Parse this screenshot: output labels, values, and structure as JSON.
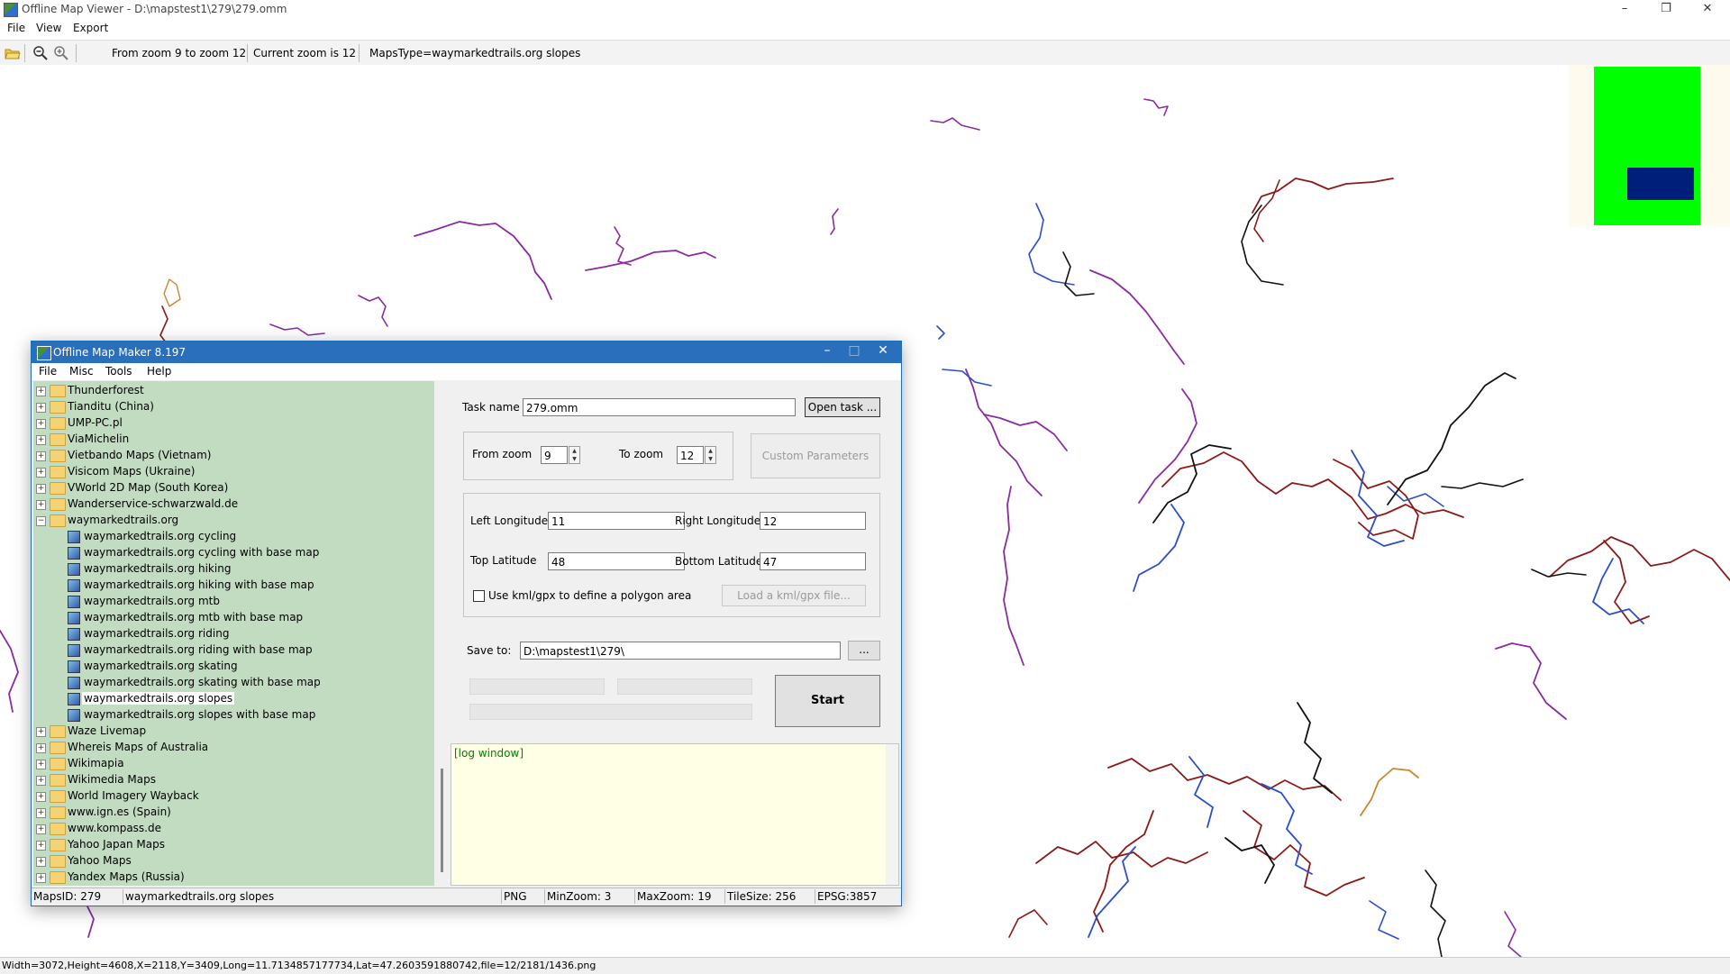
{
  "window": {
    "title": "Offline Map Viewer - D:\\mapstest1\\279\\279.omm",
    "minimize": "–",
    "restore": "❐",
    "close": "✕"
  },
  "menu": [
    "File",
    "View",
    "Export"
  ],
  "toolbar": {
    "zoom_range": "From zoom 9 to zoom 12",
    "current_zoom": "Current zoom is 12",
    "maps_type": "MapsType=waymarkedtrails.org slopes"
  },
  "status_bar": {
    "text": "Width=3072,Height=4608,X=2118,Y=3409,Long=11.7134857177734,Lat=47.2603591880742,file=12/2181/1436.png"
  },
  "map": {
    "colors": {
      "red": "#8b1a1a",
      "blue": "#2a4fc8",
      "purple": "#8a2ba0",
      "black": "#111111",
      "orange": "#c9862f"
    }
  },
  "dialog": {
    "title": "Offline Map Maker 8.197",
    "menu": [
      "File",
      "Misc",
      "Tools",
      "Help"
    ],
    "tree": [
      {
        "label": "Thunderforest",
        "type": "folder",
        "expanded": false,
        "indent": 0
      },
      {
        "label": "Tianditu (China)",
        "type": "folder",
        "expanded": false,
        "indent": 0
      },
      {
        "label": "UMP-PC.pl",
        "type": "folder",
        "expanded": false,
        "indent": 0
      },
      {
        "label": "ViaMichelin",
        "type": "folder",
        "expanded": false,
        "indent": 0
      },
      {
        "label": "Vietbando Maps (Vietnam)",
        "type": "folder",
        "expanded": false,
        "indent": 0
      },
      {
        "label": "Visicom Maps (Ukraine)",
        "type": "folder",
        "expanded": false,
        "indent": 0
      },
      {
        "label": "VWorld 2D Map (South Korea)",
        "type": "folder",
        "expanded": false,
        "indent": 0
      },
      {
        "label": "Wanderservice-schwarzwald.de",
        "type": "folder",
        "expanded": false,
        "indent": 0
      },
      {
        "label": "waymarkedtrails.org",
        "type": "folder",
        "expanded": true,
        "indent": 0
      },
      {
        "label": "waymarkedtrails.org cycling",
        "type": "map",
        "indent": 1
      },
      {
        "label": "waymarkedtrails.org cycling with base map",
        "type": "map",
        "indent": 1
      },
      {
        "label": "waymarkedtrails.org hiking",
        "type": "map",
        "indent": 1
      },
      {
        "label": "waymarkedtrails.org hiking with base map",
        "type": "map",
        "indent": 1
      },
      {
        "label": "waymarkedtrails.org mtb",
        "type": "map",
        "indent": 1
      },
      {
        "label": "waymarkedtrails.org mtb with base map",
        "type": "map",
        "indent": 1
      },
      {
        "label": "waymarkedtrails.org riding",
        "type": "map",
        "indent": 1
      },
      {
        "label": "waymarkedtrails.org riding with base map",
        "type": "map",
        "indent": 1
      },
      {
        "label": "waymarkedtrails.org skating",
        "type": "map",
        "indent": 1
      },
      {
        "label": "waymarkedtrails.org skating with base map",
        "type": "map",
        "indent": 1
      },
      {
        "label": "waymarkedtrails.org slopes",
        "type": "map",
        "indent": 1,
        "selected": true
      },
      {
        "label": "waymarkedtrails.org slopes with base map",
        "type": "map",
        "indent": 1
      },
      {
        "label": "Waze Livemap",
        "type": "folder",
        "expanded": false,
        "indent": 0
      },
      {
        "label": "Whereis Maps of Australia",
        "type": "folder",
        "expanded": false,
        "indent": 0
      },
      {
        "label": "Wikimapia",
        "type": "folder",
        "expanded": false,
        "indent": 0
      },
      {
        "label": "Wikimedia Maps",
        "type": "folder",
        "expanded": false,
        "indent": 0
      },
      {
        "label": "World Imagery Wayback",
        "type": "folder",
        "expanded": false,
        "indent": 0
      },
      {
        "label": "www.ign.es (Spain)",
        "type": "folder",
        "expanded": false,
        "indent": 0
      },
      {
        "label": "www.kompass.de",
        "type": "folder",
        "expanded": false,
        "indent": 0
      },
      {
        "label": "Yahoo Japan Maps",
        "type": "folder",
        "expanded": false,
        "indent": 0
      },
      {
        "label": "Yahoo Maps",
        "type": "folder",
        "expanded": false,
        "indent": 0
      },
      {
        "label": "Yandex Maps (Russia)",
        "type": "folder",
        "expanded": false,
        "indent": 0
      }
    ],
    "task_name_label": "Task name",
    "task_name": "279.omm",
    "open_task": "Open task ...",
    "from_zoom_label": "From zoom",
    "from_zoom": "9",
    "to_zoom_label": "To zoom",
    "to_zoom": "12",
    "custom_params": "Custom Parameters",
    "left_lon_label": "Left Longitude",
    "left_lon": "11",
    "right_lon_label": "Right Longitude",
    "right_lon": "12",
    "top_lat_label": "Top Latitude",
    "top_lat": "48",
    "bottom_lat_label": "Bottom Latitude",
    "bottom_lat": "47",
    "kml_checkbox_label": "Use kml/gpx to define a polygon area",
    "load_kml": "Load a kml/gpx file...",
    "save_to_label": "Save to:",
    "save_to": "D:\\mapstest1\\279\\",
    "browse": "...",
    "start": "Start",
    "log": "[log window]",
    "status": {
      "maps_id": "MapsID: 279",
      "maps_name": "waymarkedtrails.org slopes",
      "format": "PNG",
      "min_zoom": "MinZoom: 3",
      "max_zoom": "MaxZoom: 19",
      "tile_size": "TileSize: 256",
      "epsg": "EPSG:3857"
    }
  }
}
